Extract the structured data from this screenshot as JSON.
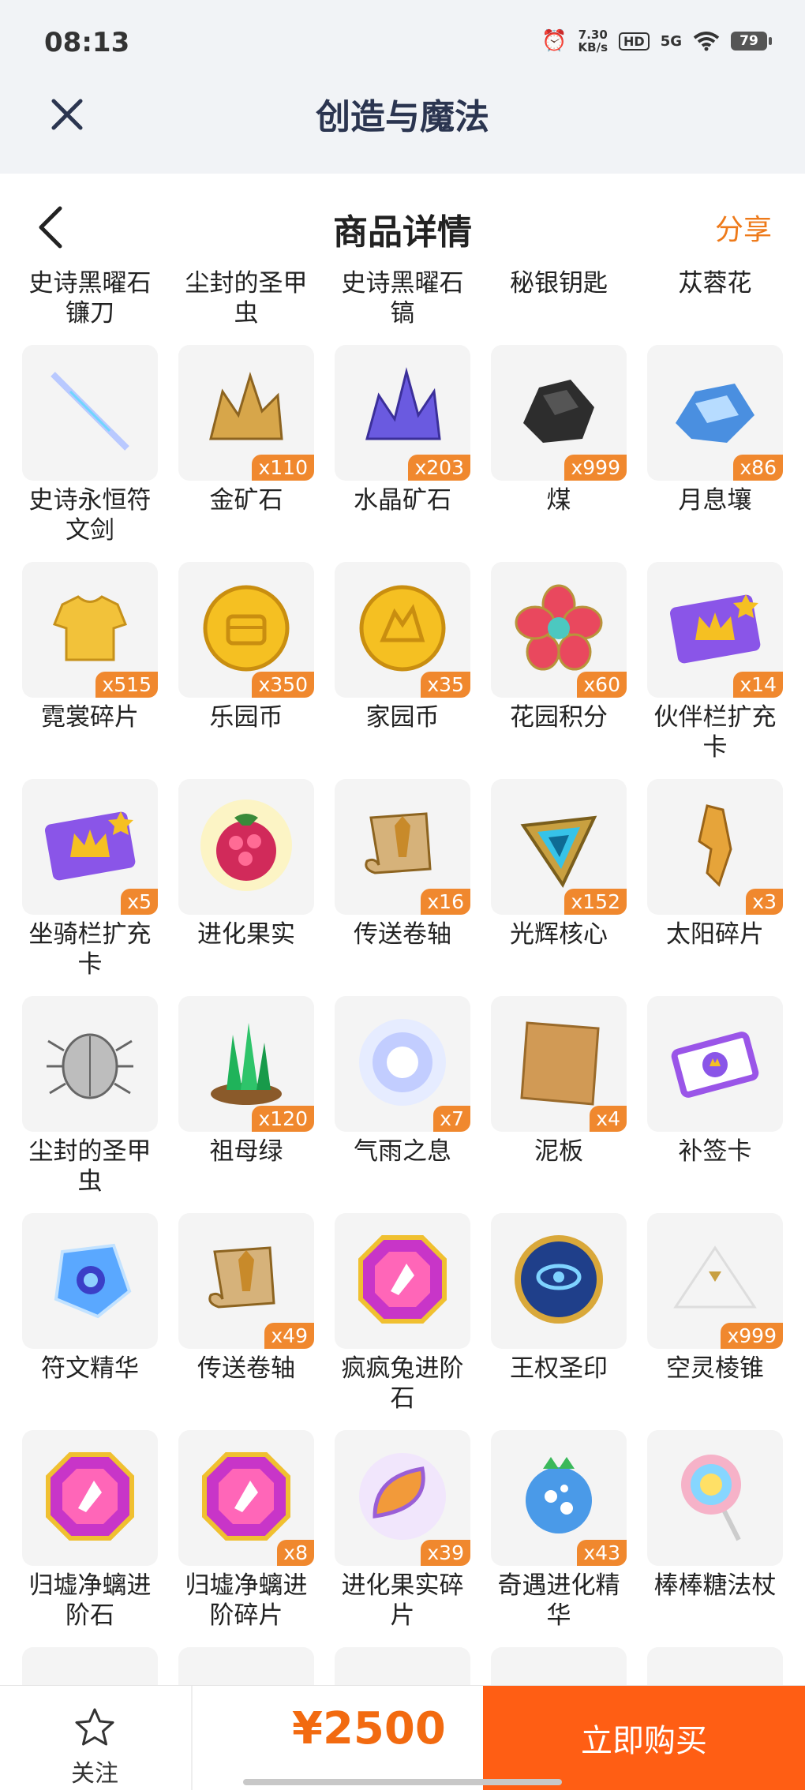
{
  "status_bar": {
    "time": "08:13",
    "net_speed_value": "7.30",
    "net_speed_unit": "KB/s",
    "hd": "HD",
    "signal": "5G",
    "battery": "79"
  },
  "app_header": {
    "title": "创造与魔法"
  },
  "page_header": {
    "title": "商品详情",
    "share": "分享"
  },
  "colors": {
    "accent": "#ff5e14",
    "price": "#f26a10",
    "badge": "#f0882e",
    "header_bg": "#f1f3f6"
  },
  "items": [
    {
      "name": "史诗黑曜石镰刀",
      "count": "",
      "icon": "scythe-icon"
    },
    {
      "name": "尘封的圣甲虫",
      "count": "",
      "icon": "beetle-icon"
    },
    {
      "name": "史诗黑曜石镐",
      "count": "",
      "icon": "pickaxe-icon"
    },
    {
      "name": "秘银钥匙",
      "count": "",
      "icon": "key-icon"
    },
    {
      "name": "苁蓉花",
      "count": "",
      "icon": "flower-icon"
    },
    {
      "name": "史诗永恒符文剑",
      "count": "",
      "icon": "sword-icon"
    },
    {
      "name": "金矿石",
      "count": "x110",
      "icon": "gold-ore-icon"
    },
    {
      "name": "水晶矿石",
      "count": "x203",
      "icon": "crystal-ore-icon"
    },
    {
      "name": "煤",
      "count": "x999",
      "icon": "coal-icon"
    },
    {
      "name": "月息壤",
      "count": "x86",
      "icon": "moon-soil-icon"
    },
    {
      "name": "霓裳碎片",
      "count": "x515",
      "icon": "shirt-icon"
    },
    {
      "name": "乐园币",
      "count": "x350",
      "icon": "coin-icon"
    },
    {
      "name": "家园币",
      "count": "x35",
      "icon": "home-coin-icon"
    },
    {
      "name": "花园积分",
      "count": "x60",
      "icon": "flower-badge-icon"
    },
    {
      "name": "伙伴栏扩充卡",
      "count": "x14",
      "icon": "card-icon"
    },
    {
      "name": "坐骑栏扩充卡",
      "count": "x5",
      "icon": "card-icon"
    },
    {
      "name": "进化果实",
      "count": "",
      "icon": "berry-icon"
    },
    {
      "name": "传送卷轴",
      "count": "x16",
      "icon": "scroll-icon"
    },
    {
      "name": "光辉核心",
      "count": "x152",
      "icon": "core-icon"
    },
    {
      "name": "太阳碎片",
      "count": "x3",
      "icon": "shard-icon"
    },
    {
      "name": "尘封的圣甲虫",
      "count": "",
      "icon": "beetle-icon"
    },
    {
      "name": "祖母绿",
      "count": "x120",
      "icon": "emerald-icon"
    },
    {
      "name": "气雨之息",
      "count": "x7",
      "icon": "orb-icon"
    },
    {
      "name": "泥板",
      "count": "x4",
      "icon": "tablet-icon"
    },
    {
      "name": "补签卡",
      "count": "",
      "icon": "ticket-icon"
    },
    {
      "name": "符文精华",
      "count": "",
      "icon": "rune-icon"
    },
    {
      "name": "传送卷轴",
      "count": "x49",
      "icon": "scroll-icon"
    },
    {
      "name": "疯疯兔进阶石",
      "count": "",
      "icon": "gem-icon"
    },
    {
      "name": "王权圣印",
      "count": "",
      "icon": "seal-icon"
    },
    {
      "name": "空灵棱锥",
      "count": "x999",
      "icon": "pyramid-icon"
    },
    {
      "name": "归墟净螭进阶石",
      "count": "",
      "icon": "gem-icon"
    },
    {
      "name": "归墟净螭进阶碎片",
      "count": "x8",
      "icon": "gem-icon"
    },
    {
      "name": "进化果实碎片",
      "count": "x39",
      "icon": "fruit-slice-icon"
    },
    {
      "name": "奇遇进化精华",
      "count": "x43",
      "icon": "essence-icon"
    },
    {
      "name": "棒棒糖法杖",
      "count": "",
      "icon": "lollipop-icon"
    },
    {
      "name": "",
      "count": "",
      "icon": "item-icon"
    },
    {
      "name": "",
      "count": "",
      "icon": "item-icon"
    },
    {
      "name": "",
      "count": "",
      "icon": "item-icon"
    },
    {
      "name": "",
      "count": "",
      "icon": "item-icon"
    },
    {
      "name": "",
      "count": "",
      "icon": "item-icon"
    }
  ],
  "bottom_bar": {
    "favorite_label": "关注",
    "price": "¥2500",
    "buy_label": "立即购买"
  }
}
